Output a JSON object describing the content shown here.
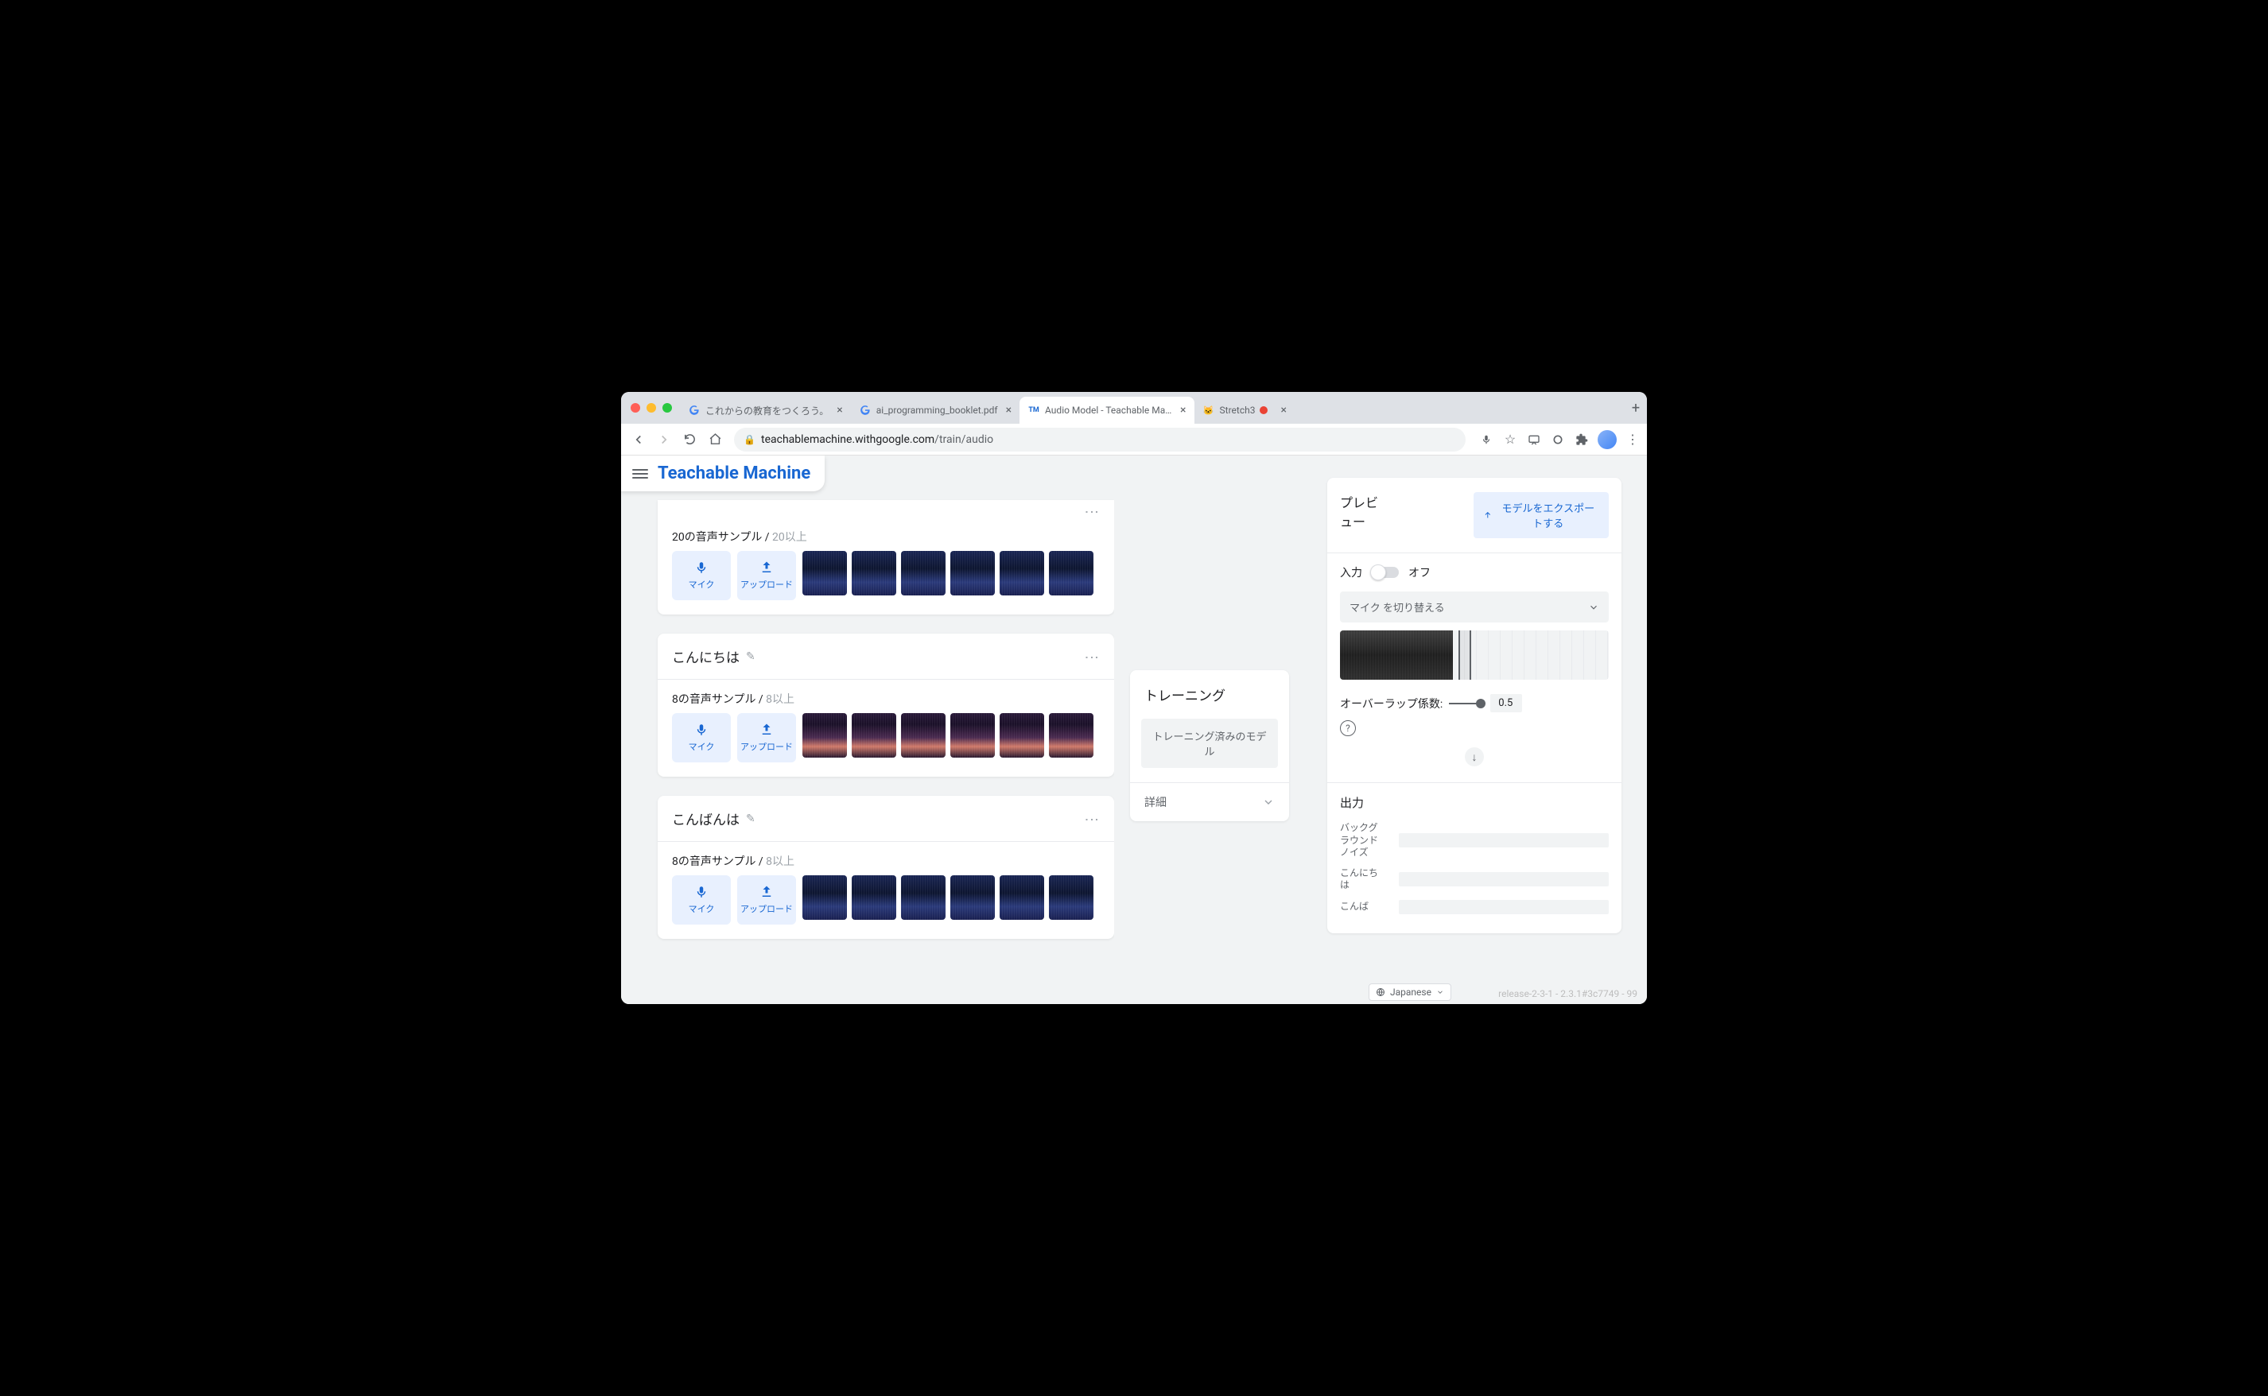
{
  "tabs": [
    {
      "favicon": "G",
      "title": "これからの教育をつくろう。"
    },
    {
      "favicon": "G",
      "title": "ai_programming_booklet.pdf"
    },
    {
      "favicon": "TM",
      "title": "Audio Model - Teachable Mach",
      "active": true
    },
    {
      "favicon": "🐱",
      "title": "Stretch3",
      "recording": true
    }
  ],
  "url": {
    "host": "teachablemachine.withgoogle.com",
    "path": "/train/audio"
  },
  "app_title": "Teachable Machine",
  "classes": [
    {
      "count": "20",
      "count_label": "の音声サンプル",
      "hint": "20以上",
      "mic": "マイク",
      "upload": "アップロード",
      "thumb_style": "blue",
      "thumb_n": 6,
      "scroll_w": 120,
      "first": true
    },
    {
      "name": "こんにちは",
      "count": "8",
      "count_label": "の音声サンプル",
      "hint": "8以上",
      "mic": "マイク",
      "upload": "アップロード",
      "thumb_style": "pink",
      "thumb_n": 6,
      "scroll_w": 300
    },
    {
      "name": "こんばんは",
      "count": "8",
      "count_label": "の音声サンプル",
      "hint": "8以上",
      "mic": "マイク",
      "upload": "アップロード",
      "thumb_style": "blue",
      "thumb_n": 6,
      "scroll_w": 300
    }
  ],
  "training": {
    "title": "トレーニング",
    "status": "トレーニング済みのモデル",
    "advanced": "詳細"
  },
  "preview": {
    "title": "プレビュー",
    "export": "モデルをエクスポートする",
    "input_label": "入力",
    "toggle_state": "オフ",
    "mic_switch": "マイク を切り替える",
    "overlap_label": "オーバーラップ係数:",
    "overlap_value": "0.5",
    "output_title": "出力",
    "outputs": [
      {
        "label": "バックグラウンド ノイズ"
      },
      {
        "label": "こんにちは"
      },
      {
        "label": "こんば"
      }
    ]
  },
  "language": "Japanese",
  "version": "release-2-3-1 - 2.3.1#3c7749 - 99"
}
